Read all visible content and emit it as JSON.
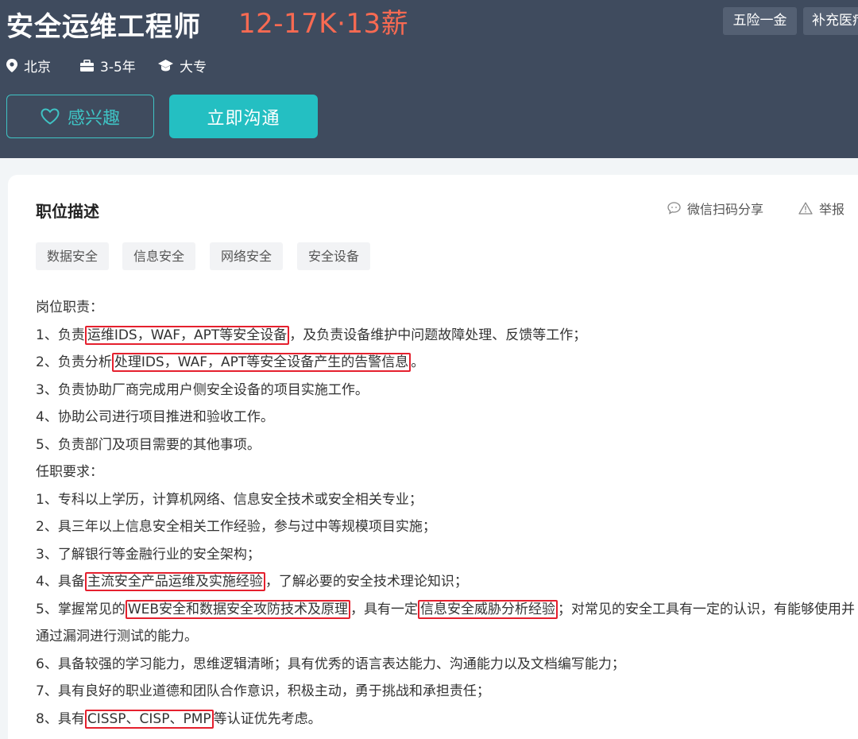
{
  "header": {
    "title": "安全运维工程师",
    "salary": "12-17K·13薪",
    "benefits": [
      "五险一金",
      "补充医疗"
    ],
    "location": "北京",
    "experience": "3-5年",
    "education": "大专",
    "interest_button": "感兴趣",
    "chat_button": "立即沟通"
  },
  "card": {
    "section_title": "职位描述",
    "share_label": "微信扫码分享",
    "report_label": "举报",
    "tags": [
      "数据安全",
      "信息安全",
      "网络安全",
      "安全设备"
    ]
  },
  "description": {
    "duties_heading": "岗位职责：",
    "d1_a": "1、负责",
    "d1_hl": "运维IDS，WAF，APT等安全设备",
    "d1_b": "，及负责设备维护中问题故障处理、反馈等工作；",
    "d2_a": "2、负责分析",
    "d2_hl": "处理IDS，WAF，APT等安全设备产生的告警信息",
    "d2_b": "。",
    "d3": "3、负责协助厂商完成用户侧安全设备的项目实施工作。",
    "d4": "4、协助公司进行项目推进和验收工作。",
    "d5": "5、负责部门及项目需要的其他事项。",
    "req_heading": "任职要求：",
    "r1": "1、专科以上学历，计算机网络、信息安全技术或安全相关专业；",
    "r2": "2、具三年以上信息安全相关工作经验，参与过中等规模项目实施；",
    "r3": "3、了解银行等金融行业的安全架构；",
    "r4_a": "4、具备",
    "r4_hl": "主流安全产品运维及实施经验",
    "r4_b": "，了解必要的安全技术理论知识；",
    "r5_a": "5、掌握常见的",
    "r5_hl1": "WEB安全和数据安全攻防技术及原理",
    "r5_b": "，具有一定",
    "r5_hl2": "信息安全威胁分析经验",
    "r5_c": "；对常见的安全工具有一定的认识，有能够使用并通过漏洞进行测试的能力。",
    "r6": "6、具备较强的学习能力，思维逻辑清晰；具有优秀的语言表达能力、沟通能力以及文档编写能力；",
    "r7": "7、具有良好的职业道德和团队合作意识，积极主动，勇于挑战和承担责任；",
    "r8_a": "8、具有",
    "r8_hl": "CISSP、CISP、PMP",
    "r8_b": "等认证优先考虑。"
  },
  "colors": {
    "header_bg": "#3f4b5e",
    "salary": "#f86a52",
    "accent": "#24bfc2",
    "highlight_box": "#e5202e"
  },
  "icons": [
    "location-pin-icon",
    "briefcase-icon",
    "graduation-cap-icon",
    "heart-icon",
    "chat-bubble-icon",
    "warning-icon"
  ]
}
